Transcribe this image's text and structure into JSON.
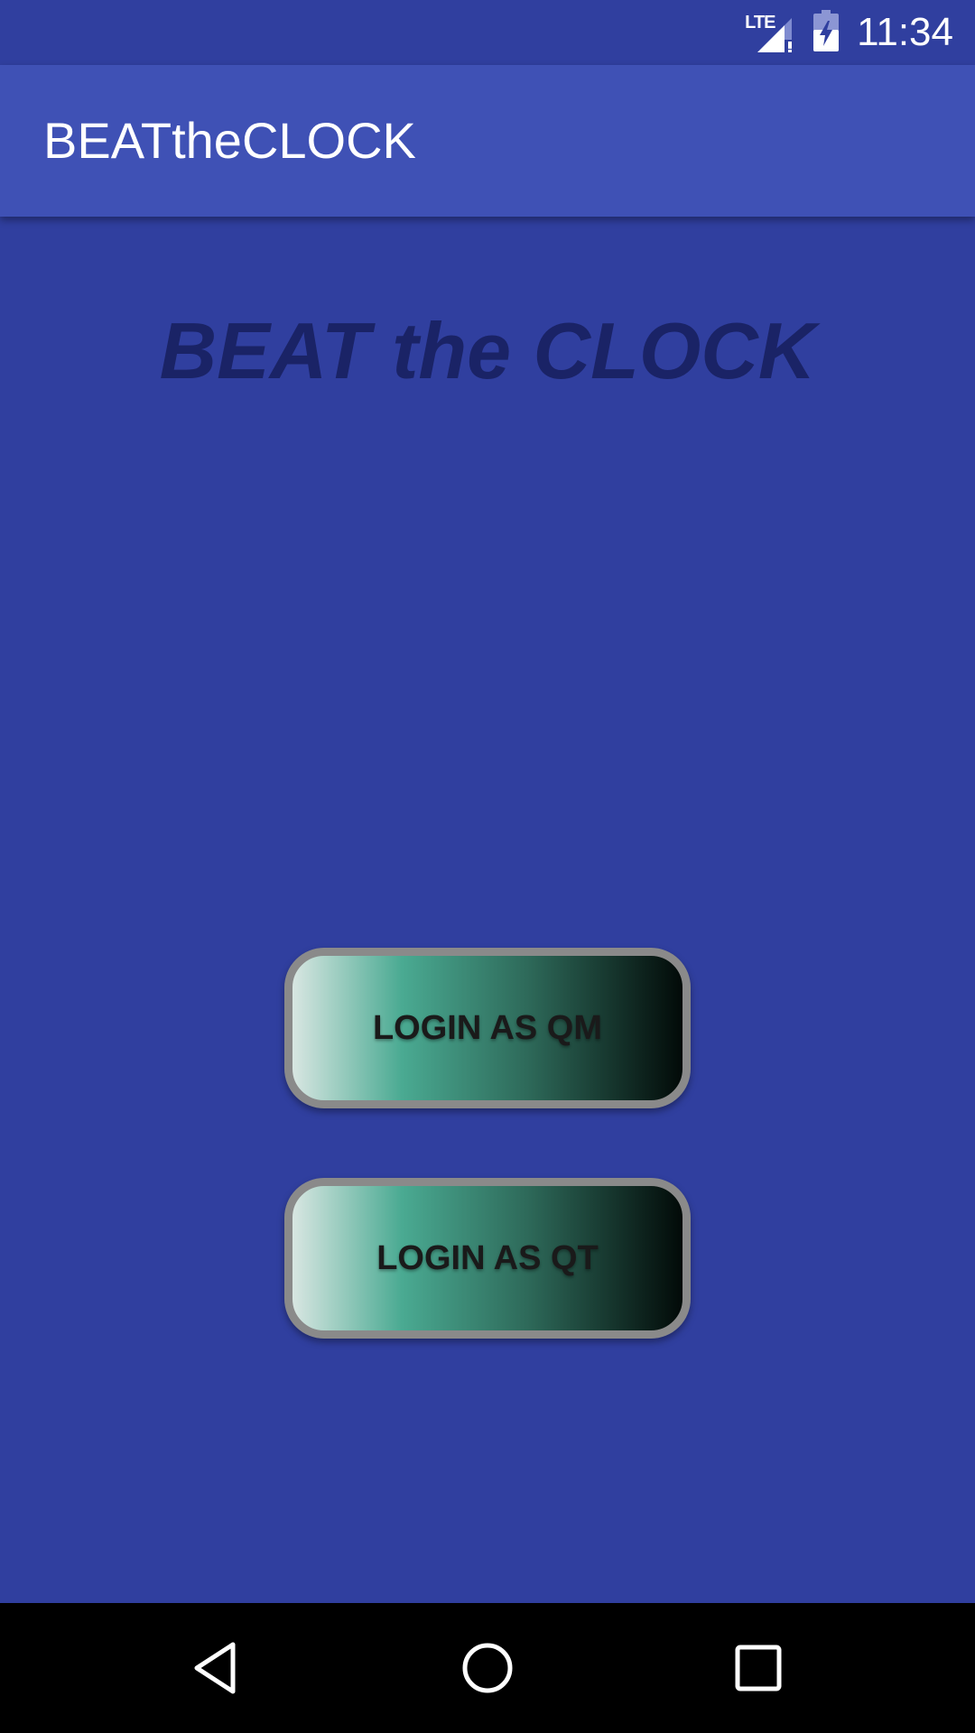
{
  "status_bar": {
    "network_label": "LTE",
    "time": "11:34",
    "icons": [
      "signal-icon",
      "battery-charging-icon"
    ]
  },
  "app_bar": {
    "title": "BEATtheCLOCK"
  },
  "main": {
    "headline": "BEAT the CLOCK",
    "buttons": [
      {
        "label": "LOGIN AS QM"
      },
      {
        "label": "LOGIN AS QT"
      }
    ]
  },
  "nav_bar": {
    "icons": [
      "back-icon",
      "home-icon",
      "recents-icon"
    ]
  },
  "colors": {
    "background": "#303f9f",
    "app_bar": "#3f51b5",
    "headline": "#1a2366",
    "button_border": "#8a8a8a",
    "nav_bar": "#000000"
  }
}
